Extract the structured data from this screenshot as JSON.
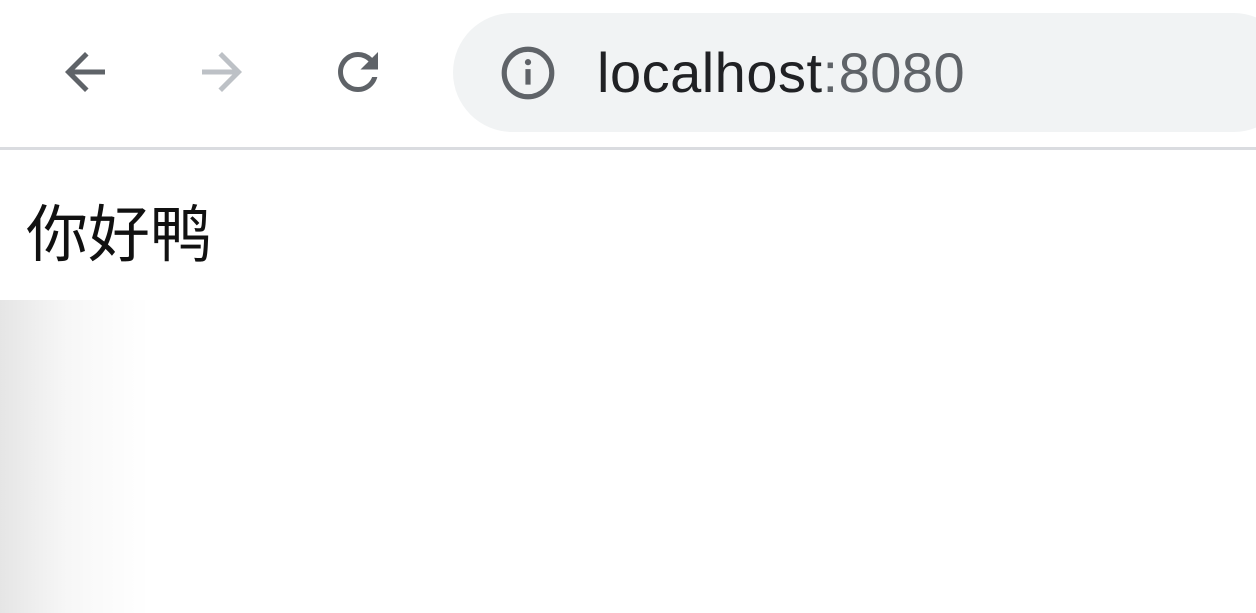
{
  "browser": {
    "url_host": "localhost",
    "url_port": ":8080",
    "icons": {
      "back": "arrow-left-icon",
      "forward": "arrow-right-icon",
      "reload": "reload-icon",
      "site_info": "info-icon"
    },
    "colors": {
      "toolbar_bg": "#ffffff",
      "omnibox_bg": "#f1f3f4",
      "icon_active": "#5f6368",
      "icon_disabled": "#bdc1c6",
      "url_host": "#202124",
      "url_port": "#5f6368"
    }
  },
  "page": {
    "text": "你好鸭"
  }
}
